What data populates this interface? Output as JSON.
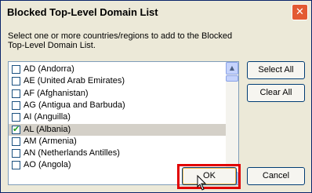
{
  "window": {
    "title": "Blocked Top-Level Domain List",
    "close_glyph": "✕"
  },
  "prompt": "Select one or more countries/regions to add to the Blocked Top-Level Domain List.",
  "list": {
    "items": [
      {
        "label": "AD (Andorra)",
        "checked": false,
        "selected": false
      },
      {
        "label": "AE (United Arab Emirates)",
        "checked": false,
        "selected": false
      },
      {
        "label": "AF (Afghanistan)",
        "checked": false,
        "selected": false
      },
      {
        "label": "AG (Antigua and Barbuda)",
        "checked": false,
        "selected": false
      },
      {
        "label": "AI (Anguilla)",
        "checked": false,
        "selected": false
      },
      {
        "label": "AL (Albania)",
        "checked": true,
        "selected": true
      },
      {
        "label": "AM (Armenia)",
        "checked": false,
        "selected": false
      },
      {
        "label": "AN (Netherlands Antilles)",
        "checked": false,
        "selected": false
      },
      {
        "label": "AO (Angola)",
        "checked": false,
        "selected": false
      }
    ],
    "scroll_up_glyph": "▲",
    "scroll_down_glyph": "▼"
  },
  "buttons": {
    "select_all": "Select All",
    "clear_all": "Clear All",
    "ok": "OK",
    "cancel": "Cancel"
  },
  "colors": {
    "highlight": "#e10000",
    "selected_row": "#d4d0c8",
    "check": "#21a121"
  },
  "icons": {
    "close": "close-icon",
    "check": "check-icon",
    "cursor": "mouse-cursor-icon"
  }
}
